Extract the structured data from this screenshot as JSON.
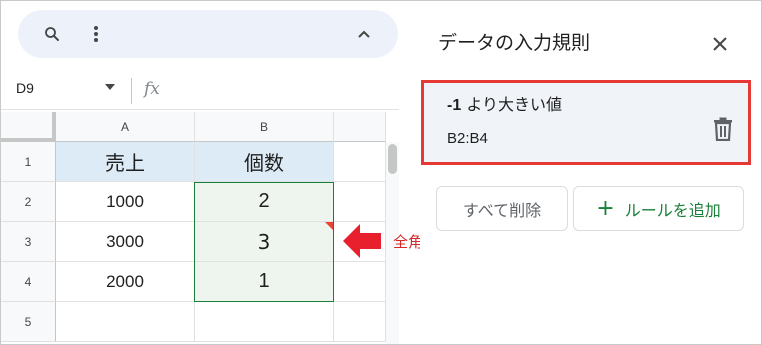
{
  "toolbar": {
    "search_icon": "search-icon",
    "more_icon": "more-vert-icon",
    "collapse_icon": "chevron-up-icon"
  },
  "formula_bar": {
    "name_box": "D9",
    "fx_label": "fx"
  },
  "sheet": {
    "columns": [
      "A",
      "B"
    ],
    "rows": [
      "1",
      "2",
      "3",
      "4",
      "5"
    ],
    "cells": {
      "a1": "売上",
      "b1": "個数",
      "a2": "1000",
      "b2": "2",
      "a3": "3000",
      "b3": "3",
      "a4": "2000",
      "b4": "1"
    },
    "header_fill": "#ddebf7",
    "selection_fill": "#eef5ee"
  },
  "annotation": {
    "label": "全角",
    "color": "#d62828"
  },
  "panel": {
    "title": "データの入力規則",
    "rule": {
      "title_bold": "-1",
      "title_rest": " より大きい値",
      "range": "B2:B4"
    },
    "clear_all_label": "すべて削除",
    "add_rule_plus": "+",
    "add_rule_label": "ルールを追加",
    "accent": "#188038",
    "highlight": "#e53935"
  }
}
